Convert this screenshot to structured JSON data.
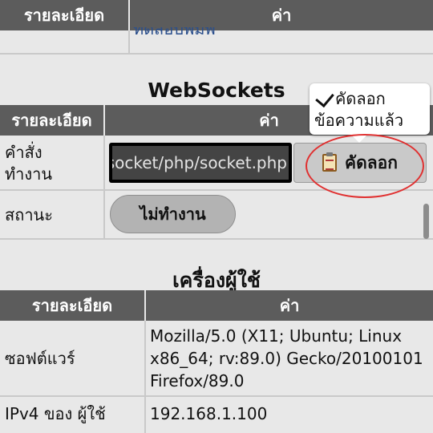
{
  "top_table": {
    "col_detail": "รายละเอียด",
    "col_value": "ค่า",
    "partial_link": "ทดสอบพิมพ์"
  },
  "websockets": {
    "title": "WebSockets",
    "col_detail": "รายละเอียด",
    "col_value": "ค่า",
    "command_label_line1": "คำสั่ง",
    "command_label_line2": "ทำงาน",
    "command_value": "socket/php/socket.php",
    "copy_button": "คัดลอก",
    "status_label": "สถานะ",
    "status_button": "ไม่ทำงาน"
  },
  "tooltip": {
    "line1": "คัดลอก",
    "line2": "ข้อความแล้ว"
  },
  "client": {
    "title": "เครื่องผู้ใช้",
    "col_detail": "รายละเอียด",
    "col_value": "ค่า",
    "software_label": "ซอฟต์แวร์",
    "software_line1": "Mozilla/5.0 (X11; Ubuntu; Linux",
    "software_line2": "x86_64; rv:89.0) Gecko/20100101",
    "software_line3": "Firefox/89.0",
    "ipv4_label": "IPv4 ของ ผู้ใช้",
    "ipv4_value": "192.168.1.100"
  },
  "colors": {
    "header_bg": "#5c5c5c",
    "page_bg": "#e8e8e8",
    "highlight_ellipse": "#e03030"
  },
  "icons": {
    "copy": "clipboard-icon",
    "tooltip": "check-icon"
  }
}
